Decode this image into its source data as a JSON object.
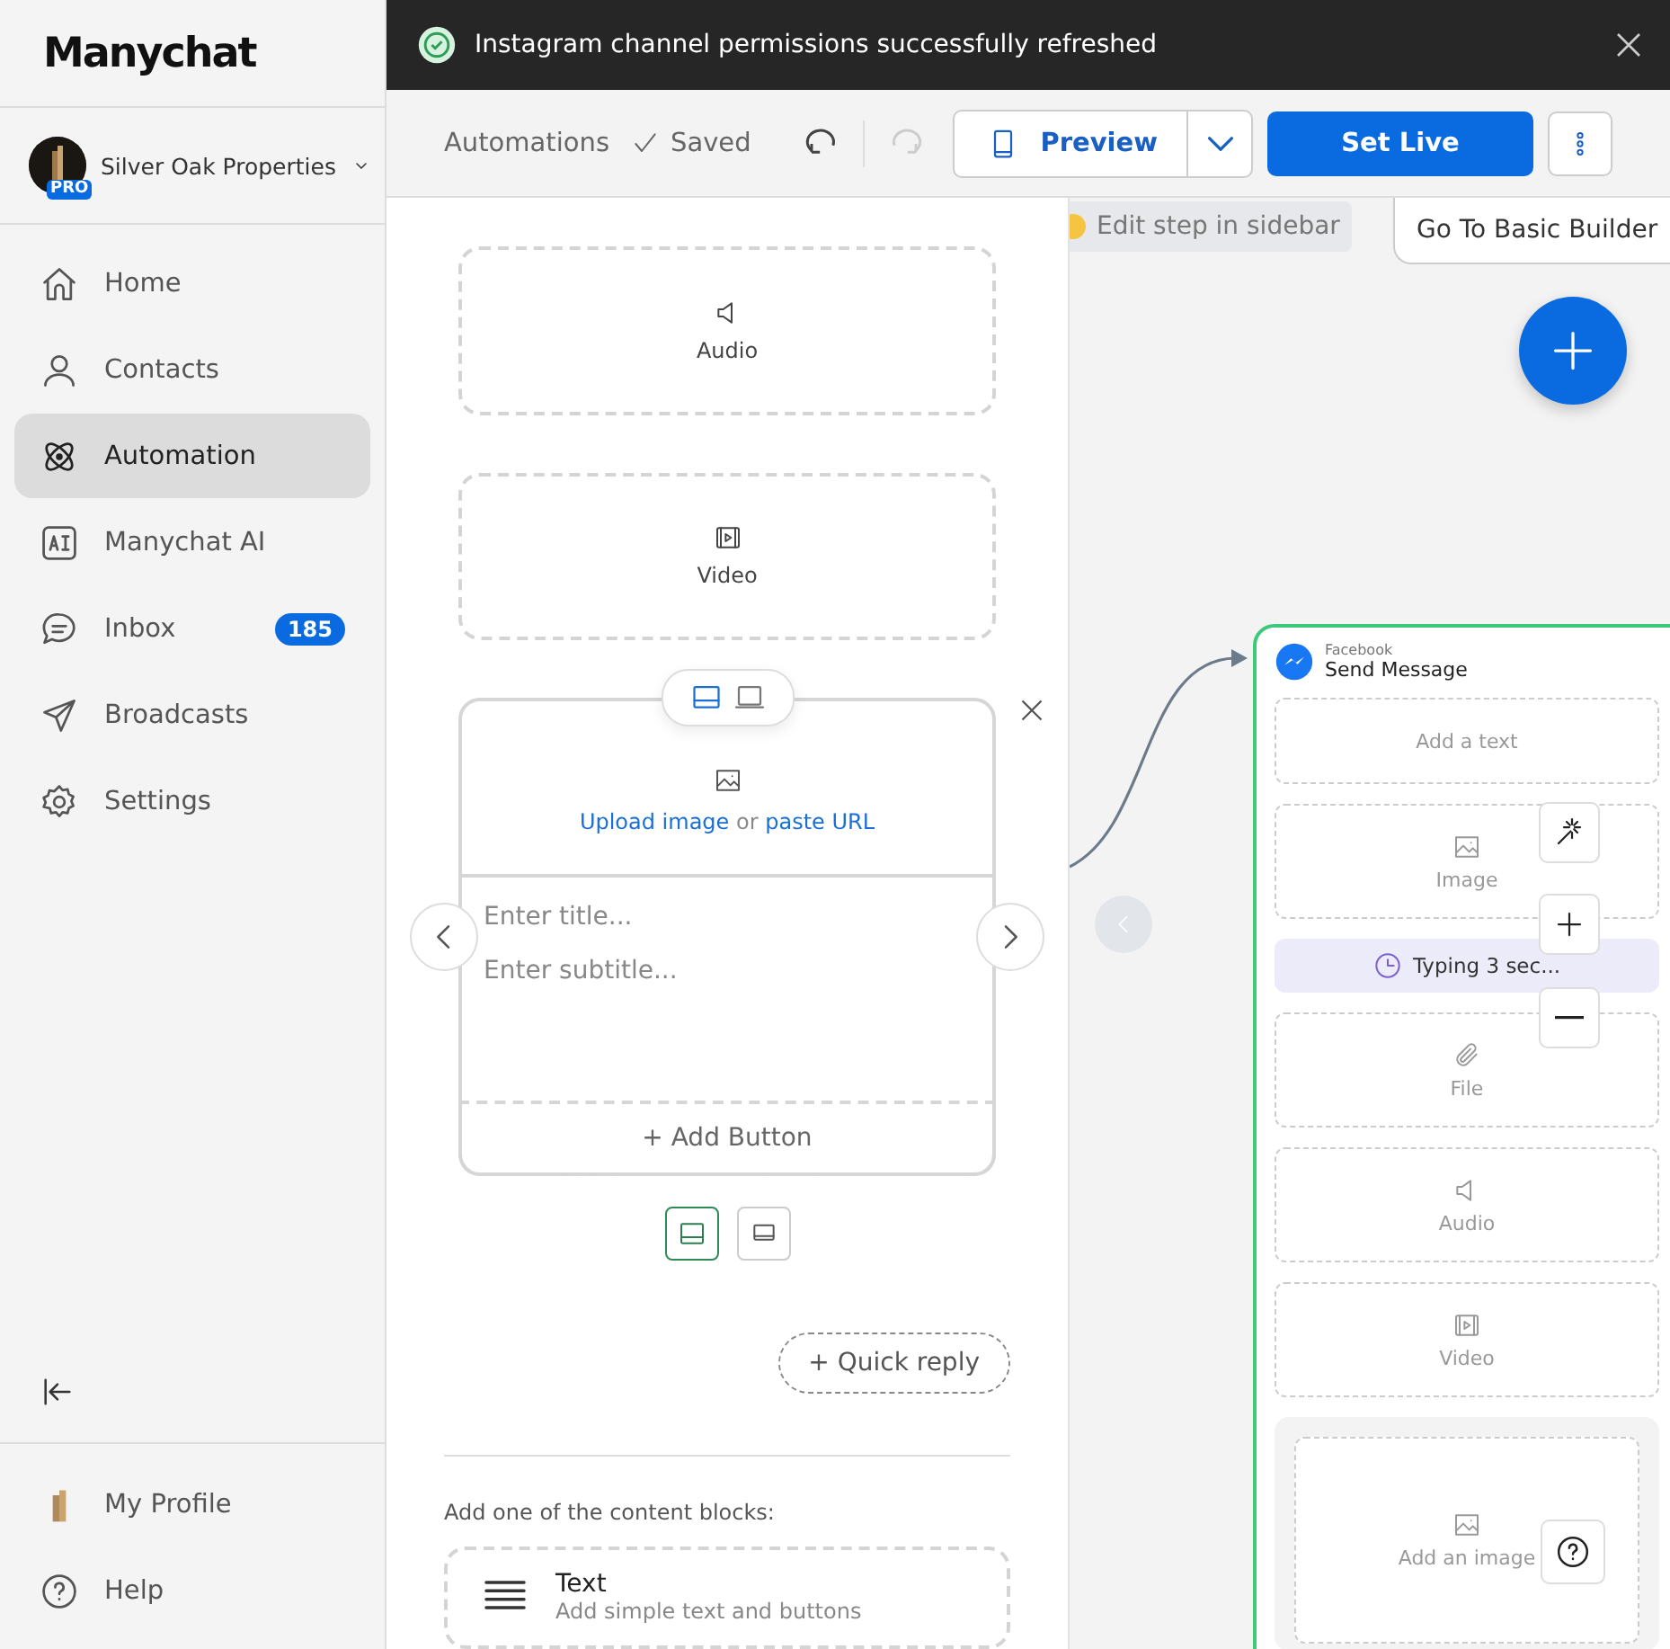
{
  "sidebar": {
    "logo": "Manychat",
    "account": {
      "name": "Silver Oak Properties",
      "badge": "PRO"
    },
    "nav": [
      {
        "kind": "home",
        "label": "Home",
        "selected": false
      },
      {
        "kind": "contacts",
        "label": "Contacts",
        "selected": false
      },
      {
        "kind": "automation",
        "label": "Automation",
        "selected": true
      },
      {
        "kind": "ai",
        "label": "Manychat AI",
        "selected": false
      },
      {
        "kind": "inbox",
        "label": "Inbox",
        "badge": "185",
        "selected": false
      },
      {
        "kind": "broadcasts",
        "label": "Broadcasts",
        "selected": false
      },
      {
        "kind": "settings",
        "label": "Settings",
        "selected": false
      }
    ],
    "footer": [
      {
        "kind": "profile",
        "label": "My Profile"
      },
      {
        "kind": "help",
        "label": "Help"
      }
    ]
  },
  "toast": {
    "message": "Instagram channel permissions successfully refreshed"
  },
  "toolbar": {
    "breadcrumb": "Automations",
    "status": "Saved",
    "redo_disabled": true,
    "preview": "Preview",
    "set_live": "Set Live"
  },
  "editor": {
    "blocks": [
      {
        "kind": "audio",
        "label": "Audio"
      },
      {
        "kind": "video",
        "label": "Video"
      }
    ],
    "card": {
      "layout_toggle": [
        {
          "selected": true
        },
        {
          "selected": false
        }
      ],
      "upload_link": "Upload image",
      "or": "or",
      "url_link": "paste URL",
      "title_placeholder": "Enter title...",
      "subtitle_placeholder": "Enter subtitle...",
      "add_button": "+ Add Button"
    },
    "size_toggle": [
      {
        "selected": true
      },
      {
        "selected": false
      }
    ],
    "quick_reply": "+ Quick reply",
    "content_blocks_heading": "Add one of the content blocks:",
    "content_blocks": [
      {
        "title": "Text",
        "description": "Add simple text and buttons"
      }
    ]
  },
  "canvas": {
    "hint": "Edit step in sidebar",
    "basic_builder": "Go To Basic Builder",
    "node": {
      "channel": "Facebook",
      "title": "Send Message",
      "items": [
        {
          "kind": "text",
          "label": "Add a text"
        },
        {
          "kind": "image",
          "label": "Image"
        },
        {
          "kind": "delay",
          "label": "Typing 3 sec..."
        },
        {
          "kind": "file",
          "label": "File"
        },
        {
          "kind": "audio",
          "label": "Audio"
        },
        {
          "kind": "video",
          "label": "Video"
        },
        {
          "kind": "card",
          "label": "Add an image"
        }
      ]
    }
  }
}
